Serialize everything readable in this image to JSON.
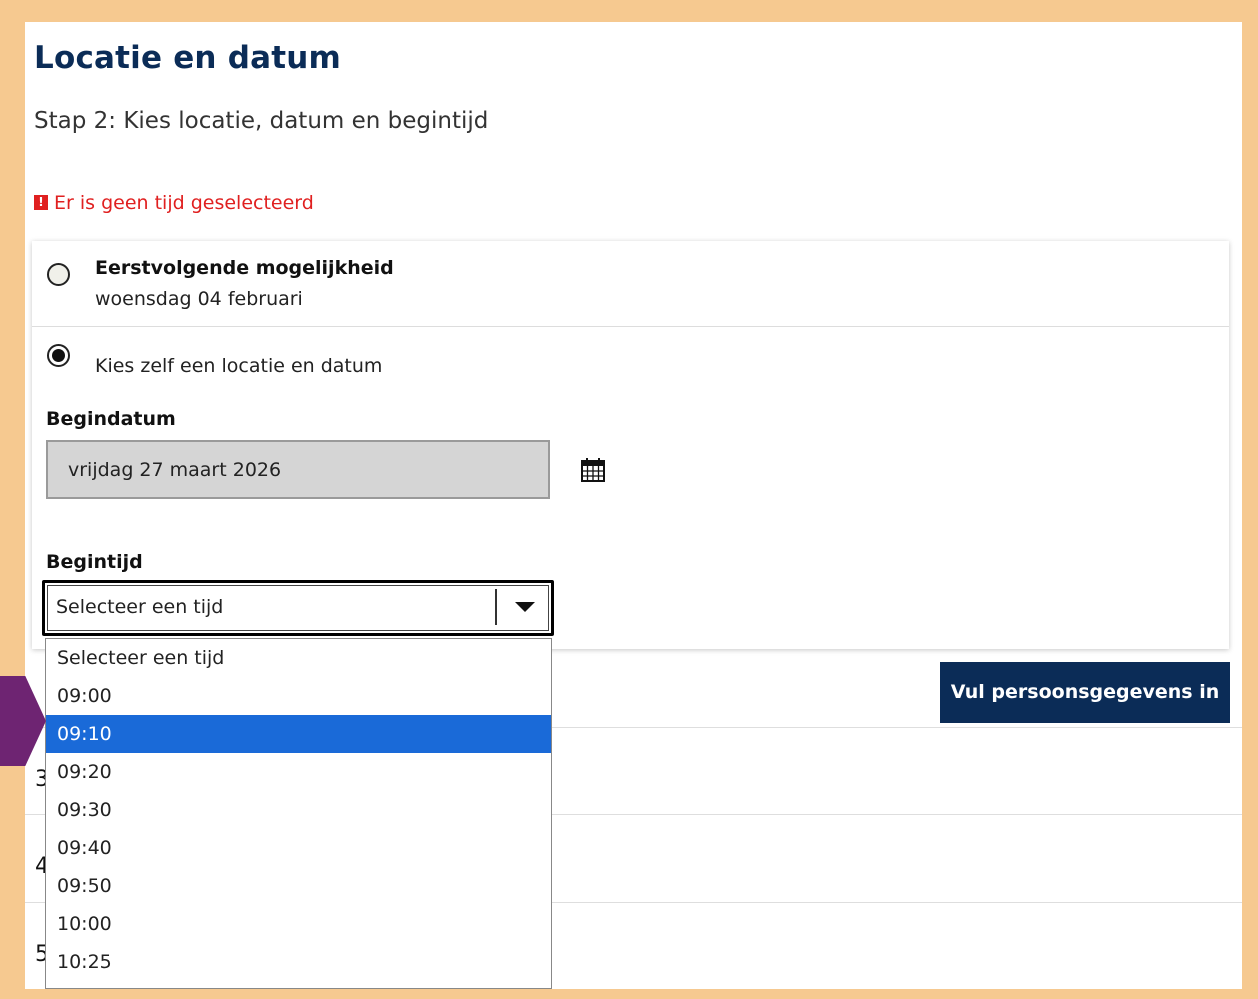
{
  "page": {
    "title": "Locatie en datum",
    "subtitle": "Stap 2: Kies locatie, datum en begintijd",
    "error": "Er is geen tijd geselecteerd"
  },
  "options": {
    "first": {
      "title": "Eerstvolgende mogelijkheid",
      "date": "woensdag 04 februari",
      "selected": false
    },
    "custom": {
      "label": "Kies zelf een locatie en datum",
      "selected": true
    }
  },
  "startdate": {
    "label": "Begindatum",
    "value": "vrijdag 27 maart 2026",
    "icon": "calendar-icon"
  },
  "starttime": {
    "label": "Begintijd",
    "value": "Selecteer een tijd",
    "options": [
      "Selecteer een tijd",
      "09:00",
      "09:10",
      "09:20",
      "09:30",
      "09:40",
      "09:50",
      "10:00",
      "10:25"
    ],
    "highlighted": "09:10"
  },
  "next_button": "Vul persoonsgegevens in",
  "steps": [
    "3",
    "4",
    "5"
  ],
  "colors": {
    "background": "#f6c990",
    "heading": "#0b2c57",
    "error": "#e02020",
    "button": "#0b2c57",
    "highlight": "#1a6ad8",
    "pointer": "#6e2472"
  }
}
